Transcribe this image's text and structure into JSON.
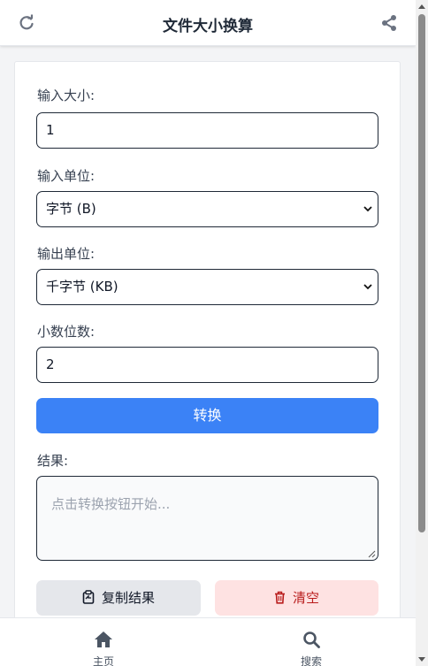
{
  "header": {
    "title": "文件大小换算",
    "left_icon": "refresh-icon",
    "right_icon": "share-icon"
  },
  "form": {
    "size_label": "输入大小:",
    "size_value": "1",
    "input_unit_label": "输入单位:",
    "input_unit_value": "字节 (B)",
    "output_unit_label": "输出单位:",
    "output_unit_value": "千字节 (KB)",
    "decimals_label": "小数位数:",
    "decimals_value": "2",
    "convert_label": "转换",
    "result_label": "结果:",
    "result_placeholder": "点击转换按钮开始...",
    "copy_label": "复制结果",
    "clear_label": "清空"
  },
  "nav": {
    "home_label": "主页",
    "search_label": "搜索"
  },
  "colors": {
    "primary": "#3b82f6",
    "danger_bg": "#fee2e2",
    "danger_text": "#b91c1c"
  }
}
